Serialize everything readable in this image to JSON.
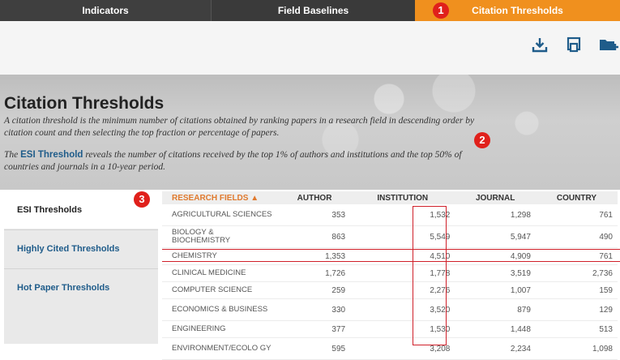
{
  "tabs": [
    {
      "label": "Indicators"
    },
    {
      "label": "Field Baselines"
    },
    {
      "label": "Citation Thresholds",
      "active": true
    }
  ],
  "badges": [
    "1",
    "2",
    "3"
  ],
  "toolbar": {
    "icons": [
      "download-icon",
      "print-icon",
      "folder-add-icon"
    ]
  },
  "hero": {
    "title": "Citation Thresholds",
    "description": "A citation threshold is the minimum number of citations obtained by ranking papers in a research field in descending order by citation count and then selecting the top fraction or percentage of papers.",
    "esi_prefix": "The ",
    "esi_link": "ESI Threshold",
    "esi_suffix": " reveals the number of citations received by the top 1% of authors and institutions and the top 50% of countries and journals in a 10-year period."
  },
  "sidebar": {
    "items": [
      {
        "label": "ESI Thresholds"
      },
      {
        "label": "Highly Cited Thresholds"
      },
      {
        "label": "Hot Paper Thresholds"
      }
    ]
  },
  "table": {
    "headers": [
      "RESEARCH FIELDS ▲",
      "AUTHOR",
      "INSTITUTION",
      "JOURNAL",
      "COUNTRY"
    ],
    "rows": [
      {
        "field": "AGRICULTURAL SCIENCES",
        "author": "353",
        "institution": "1,532",
        "journal": "1,298",
        "country": "761"
      },
      {
        "field": "BIOLOGY & BIOCHEMISTRY",
        "author": "863",
        "institution": "5,549",
        "journal": "5,947",
        "country": "490"
      },
      {
        "field": "CHEMISTRY",
        "author": "1,353",
        "institution": "4,510",
        "journal": "4,909",
        "country": "761"
      },
      {
        "field": "CLINICAL MEDICINE",
        "author": "1,726",
        "institution": "1,778",
        "journal": "3,519",
        "country": "2,736"
      },
      {
        "field": "COMPUTER SCIENCE",
        "author": "259",
        "institution": "2,276",
        "journal": "1,007",
        "country": "159"
      },
      {
        "field": "ECONOMICS & BUSINESS",
        "author": "330",
        "institution": "3,520",
        "journal": "879",
        "country": "129"
      },
      {
        "field": "ENGINEERING",
        "author": "377",
        "institution": "1,530",
        "journal": "1,448",
        "country": "513"
      },
      {
        "field": "ENVIRONMENT/ECOLO GY",
        "author": "595",
        "institution": "3,208",
        "journal": "2,234",
        "country": "1,098"
      }
    ]
  },
  "colors": {
    "accent": "#f0901e",
    "link": "#1f5c8a",
    "badge": "#e0201b",
    "header_sort": "#e07a2e"
  }
}
